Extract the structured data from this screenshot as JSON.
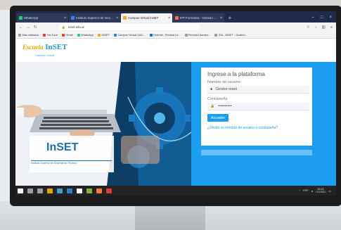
{
  "browser": {
    "tabs": [
      {
        "label": "WhatsApp",
        "active": false,
        "favicon_color": "#25d366"
      },
      {
        "label": "Instituto Superior de Innovación edu...",
        "active": false,
        "favicon_color": "#3b82f6"
      },
      {
        "label": "Campus Virtual InSET",
        "active": true,
        "favicon_color": "#f5a623"
      },
      {
        "label": "IFP Formativa - Instituto Superior...",
        "active": false,
        "favicon_color": "#ff7043"
      }
    ],
    "new_tab": "+",
    "url_host": "inset.edu.ar",
    "bookmarks": [
      {
        "label": "Más visitados",
        "color": "#9e9e9e"
      },
      {
        "label": "YouTube",
        "color": "#e53935"
      },
      {
        "label": "Gmail",
        "color": "#ea4335"
      },
      {
        "label": "WhatsApp",
        "color": "#25d366"
      },
      {
        "label": "INSET",
        "color": "#f5a623"
      },
      {
        "label": "Campus Virtual UNC...",
        "color": "#1e88e5"
      },
      {
        "label": "Hotmail - Revista Le...",
        "color": "#0078d4"
      },
      {
        "label": "Revista Literatur...",
        "color": "#9e9e9e"
      },
      {
        "label": "ISA - INSET - Gestión...",
        "color": "#9e9e9e"
      }
    ]
  },
  "site": {
    "logo_prefix": "Escuela",
    "logo_main": "InSET",
    "logo_sub": "Campus Virtual",
    "hero_brand": "InSET",
    "hero_tagline": "Instituto Superior de Enseñanza Técnica"
  },
  "login": {
    "title": "Ingrese a la plataforma",
    "username_label": "Nombre de usuario",
    "username_value": "Gestor-inset",
    "password_label": "Contraseña",
    "password_value": "••••••••••",
    "submit_label": "Acceder",
    "forgot_link": "¿Olvidó su nombre de usuario o contraseña?"
  },
  "taskbar": {
    "lang": "ESP",
    "time": "08:43",
    "date": "7/1/2021",
    "icon_colors": [
      "#ffffff",
      "#9e9e9e",
      "#9e9e9e",
      "#e0a800",
      "#3aa3d6",
      "#2f7fd0",
      "#ffffff",
      "#7cb342",
      "#ff7043",
      "#e53935"
    ]
  }
}
